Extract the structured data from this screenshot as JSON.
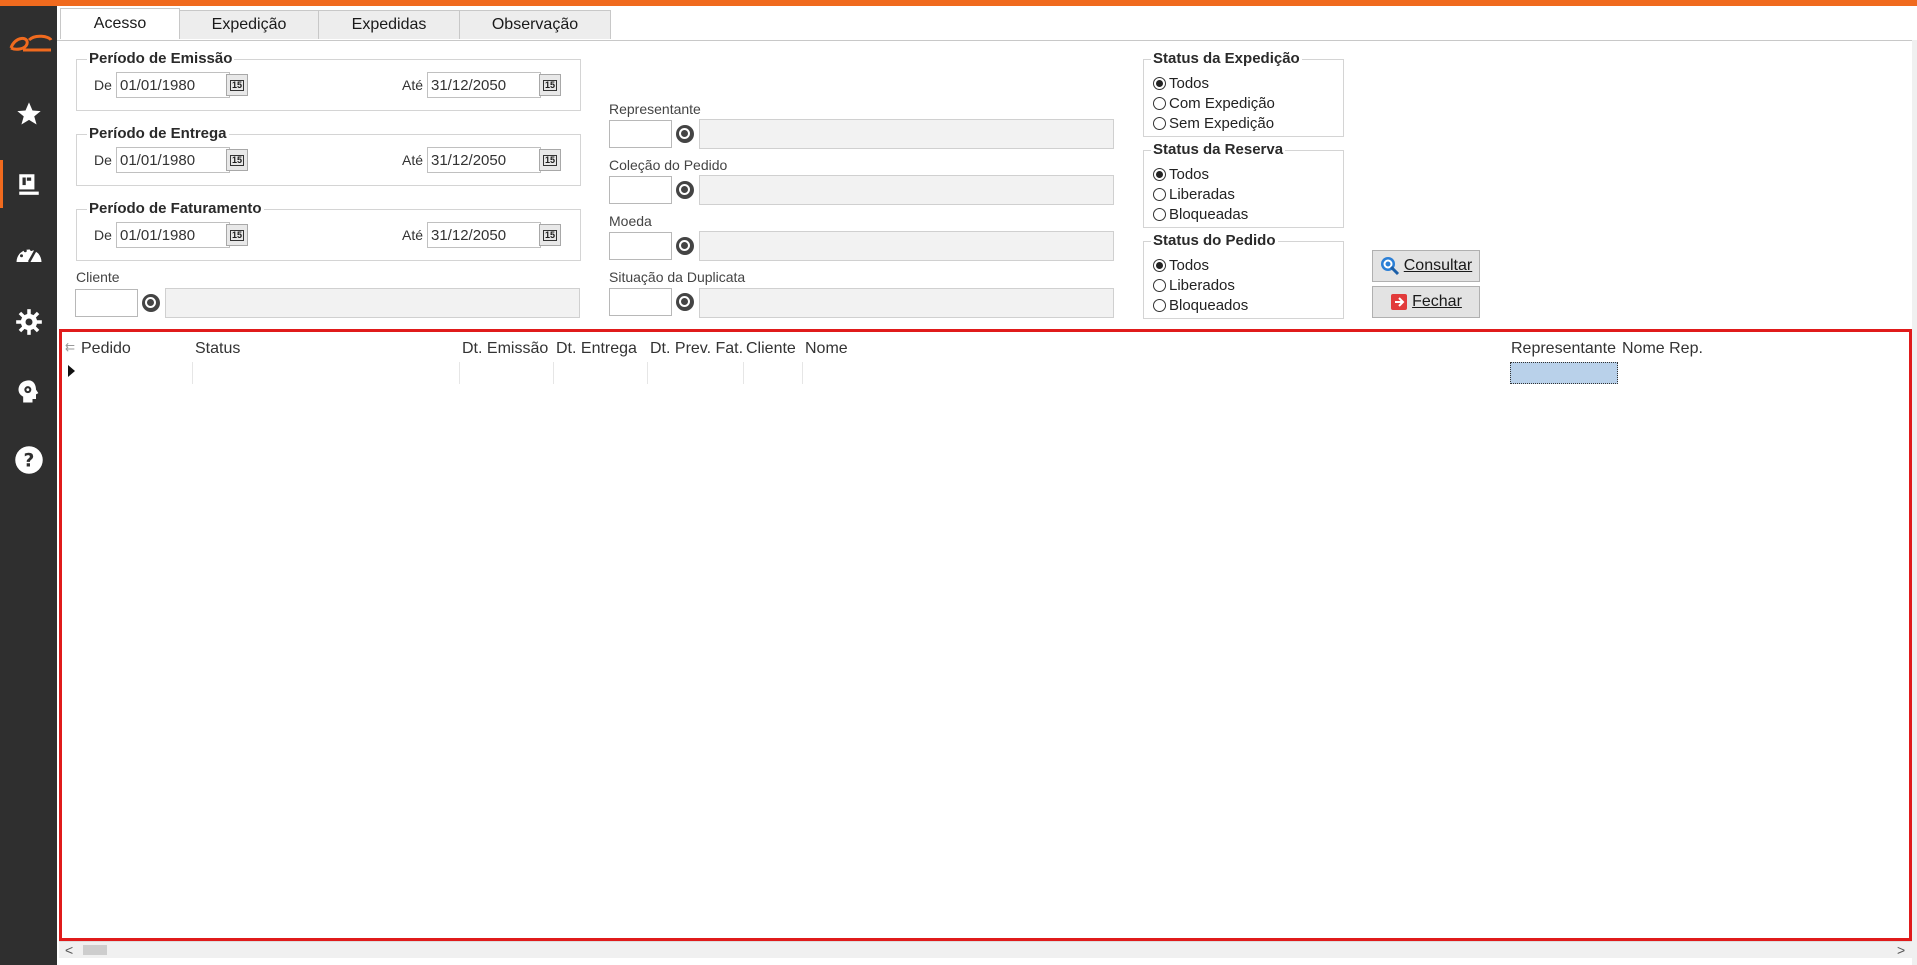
{
  "colors": {
    "accent": "#f06a1e",
    "highlight_border": "#e01b1b",
    "sidebar_bg": "#2f2f2f"
  },
  "sidebar": {
    "icons": [
      "logo-icon",
      "star-icon",
      "catalog-icon",
      "dashboard-icon",
      "gear-icon",
      "user-settings-icon",
      "help-icon"
    ]
  },
  "tabs": [
    {
      "label": "Acesso",
      "active": true
    },
    {
      "label": "Expedição"
    },
    {
      "label": "Expedidas"
    },
    {
      "label": "Observação"
    }
  ],
  "periodo_emissao": {
    "title": "Período de Emissão",
    "de_label": "De",
    "de_value": "01/01/1980",
    "ate_label": "Até",
    "ate_value": "31/12/2050"
  },
  "periodo_entrega": {
    "title": "Período de Entrega",
    "de_label": "De",
    "de_value": "01/01/1980",
    "ate_label": "Até",
    "ate_value": "31/12/2050"
  },
  "periodo_faturamento": {
    "title": "Período de Faturamento",
    "de_label": "De",
    "de_value": "01/01/1980",
    "ate_label": "Até",
    "ate_value": "31/12/2050"
  },
  "fields": {
    "cliente": "Cliente",
    "representante": "Representante",
    "colecao": "Coleção do Pedido",
    "moeda": "Moeda",
    "situacao": "Situação da Duplicata"
  },
  "status_expedicao": {
    "title": "Status da Expedição",
    "options": [
      "Todos",
      "Com Expedição",
      "Sem Expedição"
    ],
    "selected": "Todos"
  },
  "status_reserva": {
    "title": "Status da Reserva",
    "options": [
      "Todos",
      "Liberadas",
      "Bloqueadas"
    ],
    "selected": "Todos"
  },
  "status_pedido": {
    "title": "Status do Pedido",
    "options": [
      "Todos",
      "Liberados",
      "Bloqueados"
    ],
    "selected": "Todos"
  },
  "buttons": {
    "consultar": "Consultar",
    "fechar": "Fechar"
  },
  "grid": {
    "columns": [
      "Pedido",
      "Status",
      "Dt. Emissão",
      "Dt. Entrega",
      "Dt. Prev. Fat.",
      "Cliente",
      "Nome",
      "Representante",
      "Nome Rep."
    ]
  }
}
